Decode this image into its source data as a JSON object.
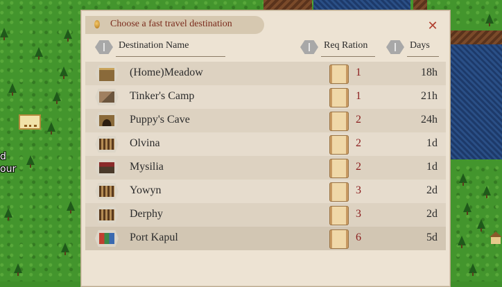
{
  "dialog": {
    "title": "Choose a fast travel destination",
    "close_glyph": "✕"
  },
  "columns": {
    "destination": "Destination Name",
    "ration": "Req Ration",
    "days": "Days"
  },
  "destinations": [
    {
      "name": "(Home)Meadow",
      "ration": "1",
      "days": "18h",
      "icon": "meadow-icon"
    },
    {
      "name": "Tinker's Camp",
      "ration": "1",
      "days": "21h",
      "icon": "camp-icon"
    },
    {
      "name": "Puppy's Cave",
      "ration": "2",
      "days": "24h",
      "icon": "cave-icon"
    },
    {
      "name": "Olvina",
      "ration": "2",
      "days": "1d",
      "icon": "town-icon"
    },
    {
      "name": "Mysilia",
      "ration": "2",
      "days": "1d",
      "icon": "city-icon"
    },
    {
      "name": "Yowyn",
      "ration": "3",
      "days": "2d",
      "icon": "town-icon"
    },
    {
      "name": "Derphy",
      "ration": "3",
      "days": "2d",
      "icon": "town-icon"
    },
    {
      "name": "Port Kapul",
      "ration": "6",
      "days": "5d",
      "icon": "port-icon"
    }
  ],
  "selected_index": 7,
  "map": {
    "label_line1": "d",
    "label_line2": "our"
  },
  "colors": {
    "title_text": "#7a2b1c",
    "ration_text": "#8a1c1c",
    "panel_bg": "#ede3d3"
  }
}
